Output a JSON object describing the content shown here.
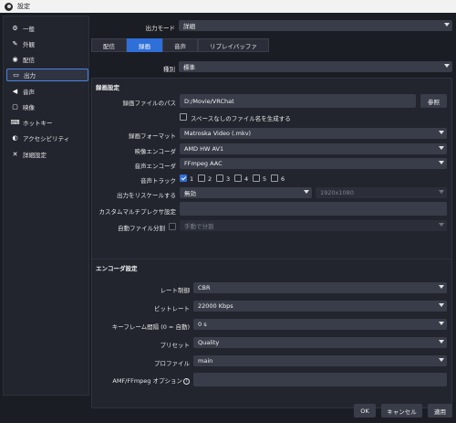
{
  "window": {
    "title": "設定"
  },
  "sidebar": {
    "items": [
      {
        "label": "一般",
        "icon": "gear-icon"
      },
      {
        "label": "外観",
        "icon": "palette-icon"
      },
      {
        "label": "配信",
        "icon": "broadcast-icon"
      },
      {
        "label": "出力",
        "icon": "monitor-icon",
        "active": true
      },
      {
        "label": "音声",
        "icon": "speaker-icon"
      },
      {
        "label": "映像",
        "icon": "screen-icon"
      },
      {
        "label": "ホットキー",
        "icon": "keyboard-icon"
      },
      {
        "label": "アクセシビリティ",
        "icon": "accessibility-icon"
      },
      {
        "label": "詳細設定",
        "icon": "wrench-icon"
      }
    ]
  },
  "output_mode": {
    "label": "出力モード",
    "value": "詳細"
  },
  "tabs": [
    "配信",
    "録画",
    "音声",
    "リプレイバッファ"
  ],
  "active_tab": "録画",
  "type_row": {
    "label": "種別",
    "value": "標準"
  },
  "recording": {
    "section_title": "録画設定",
    "path_label": "録画ファイルのパス",
    "path_value": "D:/Movie/VRChat",
    "browse_label": "参照",
    "no_space_label": "スペースなしのファイル名を生成する",
    "format_label": "録画フォーマット",
    "format_value": "Matroska Video (.mkv)",
    "video_encoder_label": "映像エンコーダ",
    "video_encoder_value": "AMD HW AV1",
    "audio_encoder_label": "音声エンコーダ",
    "audio_encoder_value": "FFmpeg AAC",
    "audio_track_label": "音声トラック",
    "tracks": [
      "1",
      "2",
      "3",
      "4",
      "5",
      "6"
    ],
    "rescale_label": "出力をリスケールする",
    "rescale_value": "無効",
    "rescale_res_value": "1920x1080",
    "custom_muxer_label": "カスタムマルチプレクサ設定",
    "auto_split_label": "自動ファイル分割",
    "auto_split_value": "手動で分割"
  },
  "encoder": {
    "section_title": "エンコーダ設定",
    "rate_control_label": "レート制御",
    "rate_control_value": "CBR",
    "bitrate_label": "ビットレート",
    "bitrate_value": "22000 Kbps",
    "keyframe_label": "キーフレーム間隔 (0 = 自動)",
    "keyframe_value": "0 s",
    "preset_label": "プリセット",
    "preset_value": "Quality",
    "profile_label": "プロファイル",
    "profile_value": "main",
    "ffmpeg_options_label": "AMF/FFmpeg オプション"
  },
  "footer": {
    "ok": "OK",
    "cancel": "キャンセル",
    "apply": "適用"
  }
}
